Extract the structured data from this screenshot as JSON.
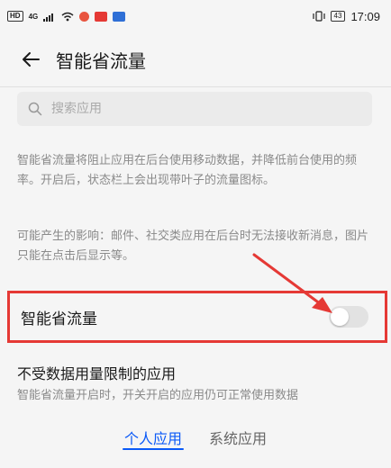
{
  "status_bar": {
    "hd": "HD",
    "network": "4G",
    "battery": "43",
    "time": "17:09"
  },
  "header": {
    "title": "智能省流量"
  },
  "search": {
    "placeholder": "搜索应用"
  },
  "description": {
    "main": "智能省流量将阻止应用在后台使用移动数据，并降低前台使用的频率。开启后，状态栏上会出现带叶子的流量图标。",
    "impact": "可能产生的影响：邮件、社交类应用在后台时无法接收新消息，图片只能在点击后显示等。"
  },
  "toggle": {
    "label": "智能省流量",
    "enabled": false
  },
  "unrestricted": {
    "title": "不受数据用量限制的应用",
    "subtitle": "智能省流量开启时，开关开启的应用仍可正常使用数据"
  },
  "tabs": [
    {
      "label": "个人应用",
      "active": true
    },
    {
      "label": "系统应用",
      "active": false
    }
  ],
  "colors": {
    "accent": "#0a59f7",
    "highlight": "#e53935"
  },
  "icons": {
    "back": "arrow-left-icon",
    "search": "search-icon"
  }
}
